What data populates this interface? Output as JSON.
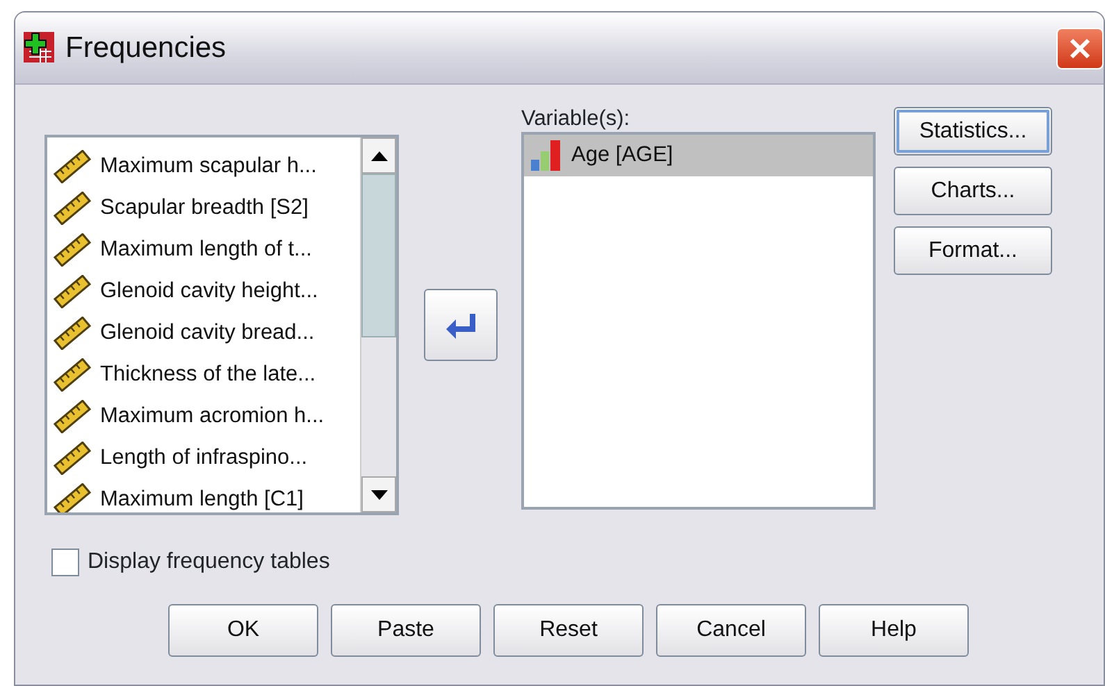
{
  "window": {
    "title": "Frequencies"
  },
  "source_list": {
    "items": [
      {
        "label": "Maximum scapular h...",
        "selected": false
      },
      {
        "label": "Scapular breadth [S2]",
        "selected": false
      },
      {
        "label": "Maximum length of t...",
        "selected": false
      },
      {
        "label": "Glenoid cavity height...",
        "selected": false
      },
      {
        "label": "Glenoid cavity bread...",
        "selected": false
      },
      {
        "label": "Thickness of the late...",
        "selected": false
      },
      {
        "label": "Maximum acromion h...",
        "selected": false
      },
      {
        "label": "Length of infraspino...",
        "selected": false
      },
      {
        "label": "Maximum length [C1]",
        "selected": false
      }
    ]
  },
  "target": {
    "label": "Variable(s):",
    "items": [
      {
        "label": "Age [AGE]",
        "selected": true
      }
    ]
  },
  "side_buttons": [
    {
      "label": "Statistics...",
      "focused": true
    },
    {
      "label": "Charts...",
      "focused": false
    },
    {
      "label": "Format...",
      "focused": false
    }
  ],
  "checkbox": {
    "label": "Display frequency tables",
    "checked": false
  },
  "buttons": [
    "OK",
    "Paste",
    "Reset",
    "Cancel",
    "Help"
  ]
}
